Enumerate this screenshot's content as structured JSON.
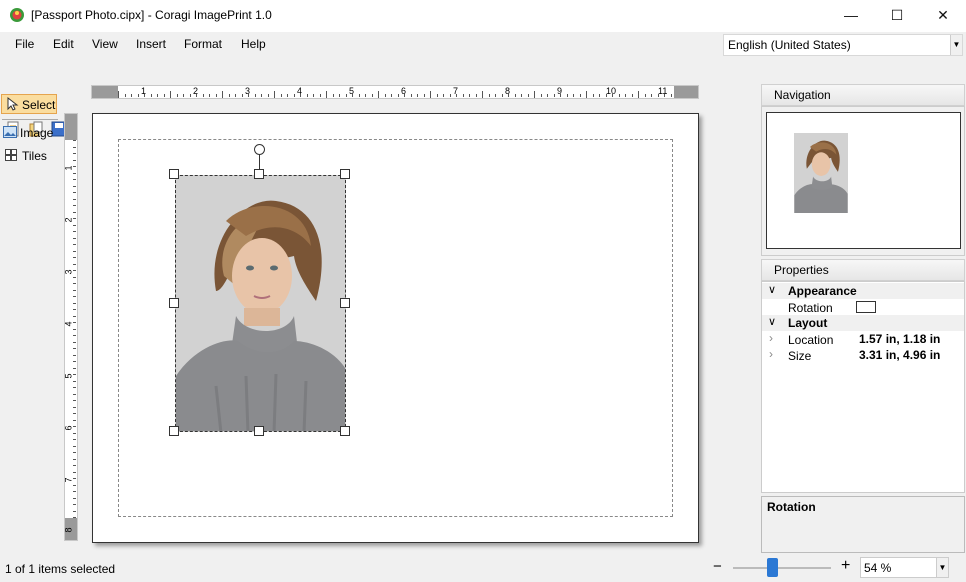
{
  "window": {
    "title": "[Passport Photo.cipx] - Coragi ImagePrint 1.0",
    "minimize_glyph": "—",
    "maximize_glyph": "☐",
    "close_glyph": "✕"
  },
  "menu": {
    "file": "File",
    "edit": "Edit",
    "view": "View",
    "insert": "Insert",
    "format": "Format",
    "help": "Help"
  },
  "language": {
    "selected": "English (United States)"
  },
  "hruler": {
    "labels": [
      "1",
      "2",
      "3",
      "4",
      "5",
      "6",
      "7",
      "8",
      "9",
      "10",
      "11"
    ]
  },
  "vruler": {
    "labels": [
      "1",
      "2",
      "3",
      "4",
      "5",
      "6",
      "7",
      "8"
    ]
  },
  "tools": {
    "select": "Select",
    "image": "Image",
    "tiles": "Tiles"
  },
  "navigation": {
    "title": "Navigation"
  },
  "properties": {
    "title": "Properties",
    "appearance": "Appearance",
    "rotation_label": "Rotation",
    "layout": "Layout",
    "location_label": "Location",
    "location_value": "1.57 in, 1.18 in",
    "size_label": "Size",
    "size_value": "3.31 in, 4.96 in"
  },
  "description": {
    "title": "Rotation"
  },
  "status": {
    "selection": "1 of 1 items selected",
    "zoom": "54 %",
    "zoom_minus": "−",
    "zoom_plus": "+",
    "zoom_level": 0.45
  },
  "colors": {
    "accent": "#fadd9f",
    "accent_border": "#e5a44e",
    "zoom_thumb": "#2b78d4"
  }
}
